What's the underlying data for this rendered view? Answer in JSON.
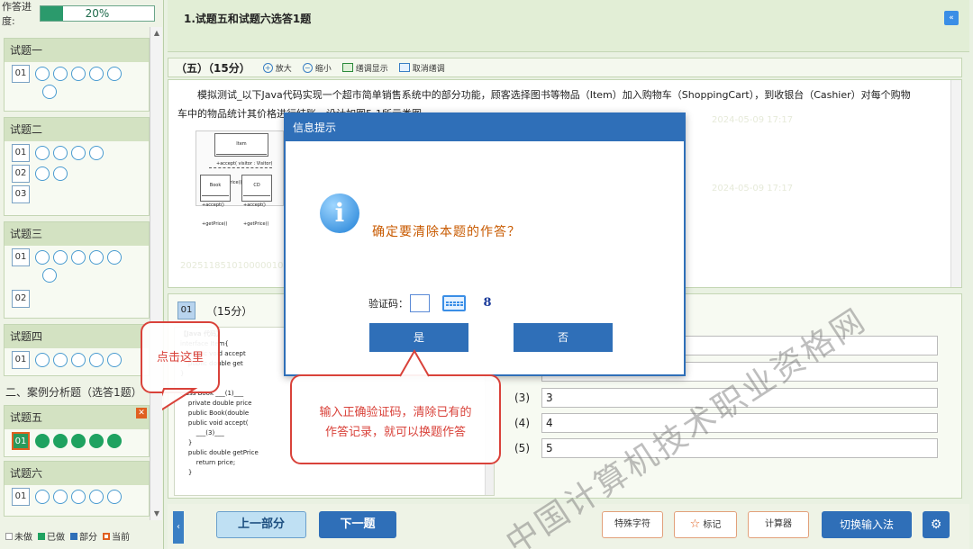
{
  "progress": {
    "label": "作答进度:",
    "percent": 20,
    "text": "20%"
  },
  "sidebar": {
    "s1": {
      "title": "试题一",
      "rows": [
        {
          "num": "01",
          "circles": 6
        }
      ]
    },
    "s2": {
      "title": "试题二",
      "rows": [
        {
          "num": "01",
          "circles": 4
        },
        {
          "num": "02",
          "circles": 2
        },
        {
          "num": "03",
          "circles": 0
        }
      ]
    },
    "s3": {
      "title": "试题三",
      "rows": [
        {
          "num": "01",
          "circles": 6
        },
        {
          "num": "02",
          "circles": 0
        }
      ]
    },
    "s4": {
      "title": "试题四",
      "rows": [
        {
          "num": "01",
          "circles": 5
        }
      ]
    },
    "group": "二、案例分析题（选答1题）",
    "s5": {
      "title": "试题五",
      "rows": [
        {
          "num": "01",
          "circles": 5
        }
      ]
    },
    "s6": {
      "title": "试题六",
      "rows": [
        {
          "num": "01",
          "circles": 5
        }
      ]
    },
    "legend": {
      "undone": "未做",
      "done": "已做",
      "partial": "部分",
      "current": "当前"
    }
  },
  "question": {
    "title": "1.试题五和试题六选答1题",
    "score": "（五）（15分）",
    "zoom_in": "放大",
    "zoom_out": "缩小",
    "highlight": "缮调显示",
    "cancel_highlight": "取消缮调",
    "passage_line1": "模拟测试_以下Java代码实现一个超市简单销售系统中的部分功能，顾客选择图书等物品（Item）加入购物车（ShoppingCart），到收银台（Cashier）对每个购物",
    "passage_line2": "车中的物品统计其价格进行结账。设计如图5-1所示类图。",
    "uml_item": "Item",
    "uml_item_ops": "+accept( visitor : Visitor)\n+getPrice()",
    "uml_book": "Book",
    "uml_cd": "CD",
    "uml_sub_ops": "+accept()\n+getPrice()"
  },
  "answer": {
    "num": "01",
    "score": "（15分）",
    "code_lines": [
      "【Java 代码】",
      "interface Item{",
      "    public void accept",
      "    public double get",
      "}",
      "",
      "class Book ___(1)___",
      "    private double price",
      "    public Book(double",
      "    public void accept(",
      "        ___(3)___",
      "    }",
      "    public double getPrice",
      "        return price;",
      "    }"
    ],
    "rows": [
      {
        "label": "(3)",
        "value": "3"
      },
      {
        "label": "(4)",
        "value": "4"
      },
      {
        "label": "(5)",
        "value": "5"
      }
    ]
  },
  "bottom": {
    "prev": "上一部分",
    "next": "下一题",
    "special": "特殊字符",
    "mark": "标记",
    "calc": "计算器",
    "ime": "切换输入法"
  },
  "dialog": {
    "title": "信息提示",
    "message": "确定要清除本题的作答？",
    "captcha_label": "验证码：",
    "captcha": "8",
    "yes": "是",
    "no": "否"
  },
  "callouts": {
    "click_here": "点击这里",
    "hint_line1": "输入正确验证码，清除已有的",
    "hint_line2": "作答记录，就可以换题作答"
  },
  "watermark": "中国计算机技术职业资格网",
  "colors": {
    "accent": "#2f6fb8",
    "done": "#1fa260",
    "current": "#e06020",
    "callout": "#d9423a"
  }
}
